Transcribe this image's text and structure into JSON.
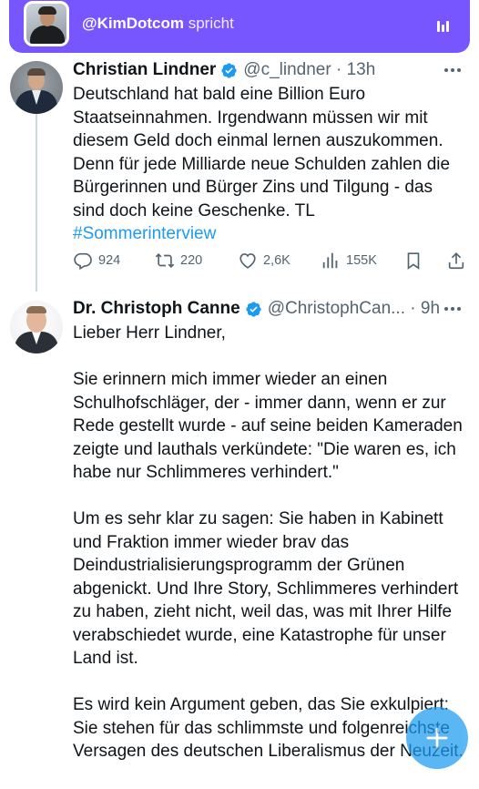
{
  "spaces_banner": {
    "host_handle": "@KimDotcom",
    "status": "spricht",
    "icon": "audio-bars-icon",
    "color": "#7856ff"
  },
  "tweets": [
    {
      "display_name": "Christian Lindner",
      "verified": true,
      "handle": "@c_lindner",
      "separator": "·",
      "time": "13h",
      "text_lines": [
        "Deutschland hat bald eine Billion Euro",
        "Staatseinnahmen. Irgendwann müssen wir mit",
        "diesem Geld doch einmal lernen auszukommen.",
        "Denn für jede Milliarde neue Schulden zahlen die",
        "Bürgerinnen und Bürger Zins und Tilgung - das",
        "sind doch keine Geschenke. TL"
      ],
      "hashtag": "#Sommerinterview",
      "actions": {
        "replies": "924",
        "reposts": "220",
        "likes": "2,6K",
        "views": "155K"
      }
    },
    {
      "display_name": "Dr. Christoph Canne",
      "verified": true,
      "handle": "@ChristophCan...",
      "separator": "·",
      "time": "9h",
      "paragraphs": [
        "Lieber Herr Lindner,",
        "Sie erinnern mich immer wieder an einen Schulhofschläger, der - immer dann, wenn er zur Rede gestellt wurde - auf seine beiden Kameraden zeigte und lauthals verkündete: \"Die waren es, ich habe nur Schlimmeres verhindert.\"",
        "Um es sehr klar zu sagen: Sie haben in Kabinett und Fraktion immer wieder brav das Deindustrialisierungsprogramm der Grünen abgenickt. Und Ihre Story, Schlimmeres verhindert zu haben, zieht nicht, weil das, was mit Ihrer Hilfe verabschiedet wurde, eine Katastrophe für unser Land ist.",
        "Es wird kein Argument geben, das Sie exkulpiert: Sie stehen für das schlimmste und folgenreichste Versagen des deutschen Liberalismus der Neuzeit."
      ]
    }
  ],
  "colors": {
    "accent": "#1d9bf0",
    "text": "#0f1419",
    "secondary": "#536471",
    "verified": "#1d9bf0"
  },
  "compose_button": {
    "icon": "plus-icon"
  }
}
